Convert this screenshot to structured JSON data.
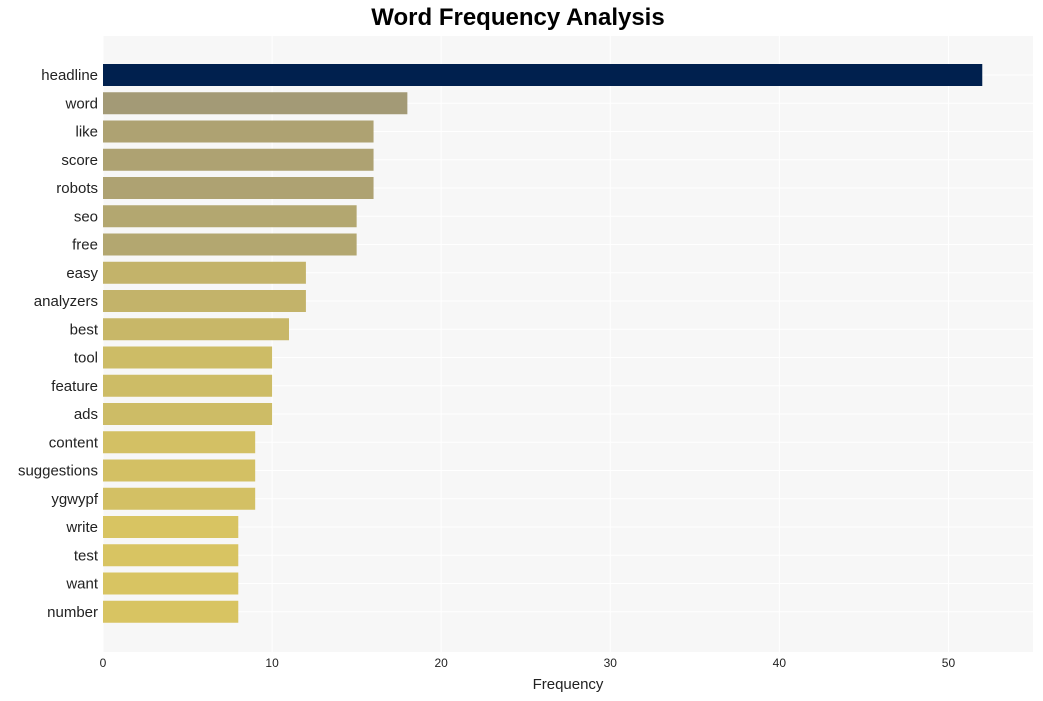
{
  "chart_data": {
    "type": "bar",
    "orientation": "horizontal",
    "title": "Word Frequency Analysis",
    "xlabel": "Frequency",
    "ylabel": "",
    "xlim": [
      0,
      55
    ],
    "xticks": [
      0,
      10,
      20,
      30,
      40,
      50
    ],
    "grid": true,
    "categories": [
      "headline",
      "word",
      "like",
      "score",
      "robots",
      "seo",
      "free",
      "easy",
      "analyzers",
      "best",
      "tool",
      "feature",
      "ads",
      "content",
      "suggestions",
      "ygwypf",
      "write",
      "test",
      "want",
      "number"
    ],
    "values": [
      52,
      18,
      16,
      16,
      16,
      15,
      15,
      12,
      12,
      11,
      10,
      10,
      10,
      9,
      9,
      9,
      8,
      8,
      8,
      8
    ],
    "colors": {
      "highlight": "#00204e",
      "high": "#a39a76",
      "low": "#d8c462",
      "plot_background": "#f7f7f7",
      "grid": "#ffffff"
    }
  }
}
